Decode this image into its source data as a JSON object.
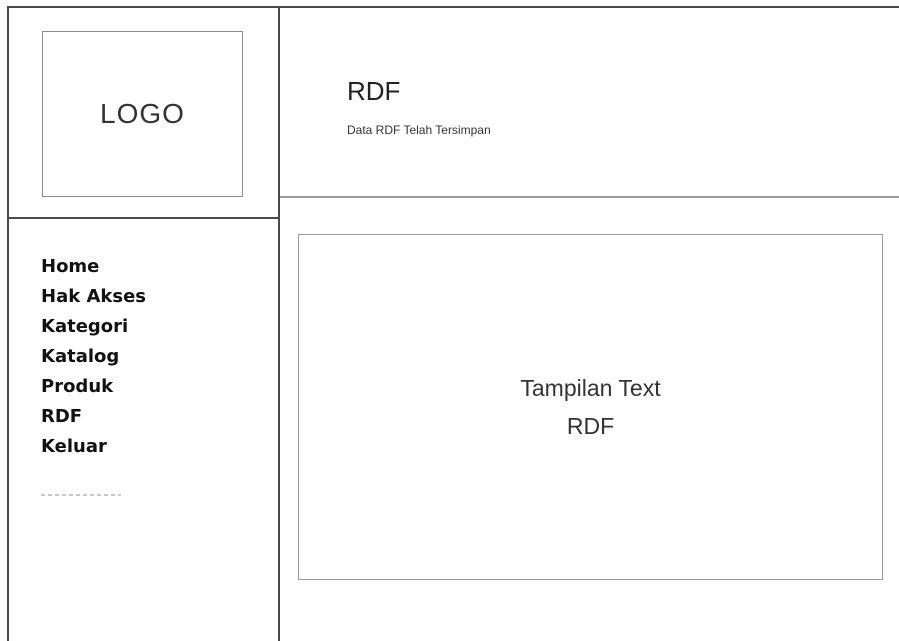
{
  "sidebar": {
    "logo_text": "LOGO",
    "menu": [
      {
        "label": "Home"
      },
      {
        "label": "Hak Akses"
      },
      {
        "label": "Kategori"
      },
      {
        "label": "Katalog"
      },
      {
        "label": "Produk"
      },
      {
        "label": "RDF"
      },
      {
        "label": "Keluar"
      }
    ]
  },
  "header": {
    "title": "RDF",
    "subtitle": "Data RDF Telah Tersimpan"
  },
  "content": {
    "line1": "Tampilan Text",
    "line2": "RDF"
  },
  "colors": {
    "border_dark": "#4a4a4a",
    "border_light": "#9a9a9a",
    "text": "#222222"
  }
}
